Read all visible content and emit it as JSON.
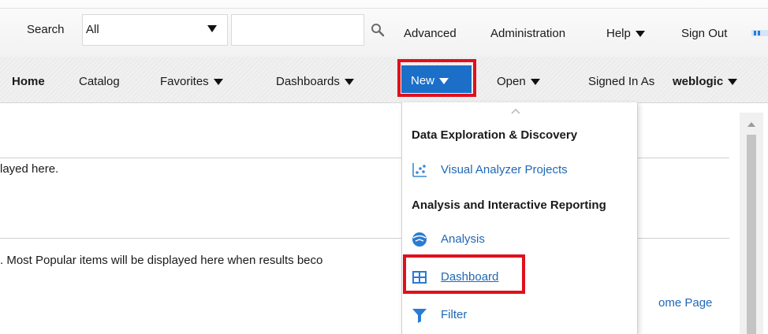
{
  "search_bar": {
    "label": "Search",
    "scope_value": "All",
    "search_value": "",
    "links": {
      "advanced": "Advanced",
      "administration": "Administration",
      "help": "Help",
      "sign_out": "Sign Out"
    }
  },
  "nav": {
    "home": "Home",
    "catalog": "Catalog",
    "favorites": "Favorites",
    "dashboards": "Dashboards",
    "new": "New",
    "open": "Open",
    "signed_in_label": "Signed In As",
    "username": "weblogic"
  },
  "new_menu": {
    "section1_heading": "Data Exploration & Discovery",
    "visual_analyzer": "Visual Analyzer Projects",
    "section2_heading": "Analysis and Interactive Reporting",
    "analysis": "Analysis",
    "dashboard": "Dashboard",
    "filter": "Filter"
  },
  "main": {
    "recent_text": "layed here.",
    "popular_text": ". Most Popular items will be displayed here when results beco",
    "home_page_link": "ome Page"
  },
  "colors": {
    "accent": "#1b6fc8",
    "highlight_box": "#e0101c",
    "link": "#2068b5"
  }
}
